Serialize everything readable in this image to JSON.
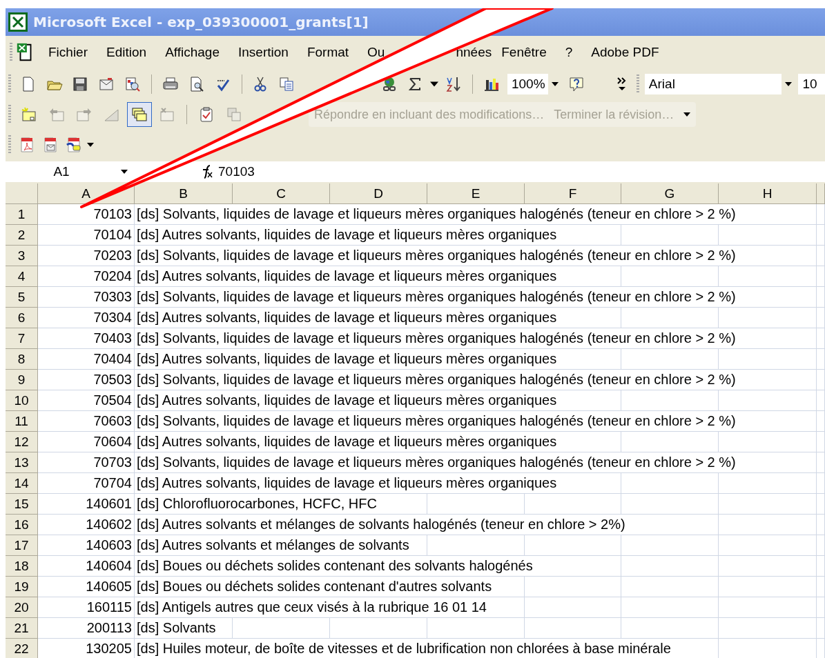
{
  "window": {
    "title": "Microsoft Excel - exp_039300001_grants[1]"
  },
  "menu": [
    "Fichier",
    "Edition",
    "Affichage",
    "Insertion",
    "Format",
    "Ou",
    "nnées",
    "Fenêtre",
    "?",
    "Adobe PDF"
  ],
  "standard_toolbar": {
    "zoom": "100%",
    "font": "Arial",
    "font_size": "10"
  },
  "reviewing_toolbar": {
    "buttons": [
      {
        "pressed": false,
        "disabled": false
      },
      {
        "pressed": false,
        "disabled": true
      },
      {
        "pressed": false,
        "disabled": true
      },
      {
        "pressed": false,
        "disabled": true
      },
      {
        "pressed": true,
        "disabled": false
      },
      {
        "pressed": false,
        "disabled": true
      },
      {
        "pressed": false,
        "disabled": false
      },
      {
        "pressed": false,
        "disabled": true
      }
    ],
    "commands": [
      {
        "label": "Répondre en incluant des modifications…",
        "disabled": true
      },
      {
        "label": "Terminer la révision…",
        "disabled": true
      }
    ]
  },
  "formula_bar": {
    "cell_reference": "A1",
    "formula": "70103"
  },
  "sheet": {
    "columns": [
      "A",
      "B",
      "C",
      "D",
      "E",
      "F",
      "G",
      "H"
    ],
    "rows": [
      {
        "header": "1",
        "a": "70103",
        "b": "[ds] Solvants, liquides de lavage et liqueurs mères organiques halogénés (teneur en chlore > 2 %)"
      },
      {
        "header": "2",
        "a": "70104",
        "b": "[ds] Autres solvants, liquides de lavage et liqueurs mères organiques"
      },
      {
        "header": "3",
        "a": "70203",
        "b": "[ds] Solvants, liquides de lavage et liqueurs mères organiques halogénés (teneur en chlore > 2 %)"
      },
      {
        "header": "4",
        "a": "70204",
        "b": "[ds] Autres solvants, liquides de lavage et liqueurs mères organiques"
      },
      {
        "header": "5",
        "a": "70303",
        "b": "[ds] Solvants, liquides de lavage et liqueurs mères organiques halogénés (teneur en chlore > 2 %)"
      },
      {
        "header": "6",
        "a": "70304",
        "b": "[ds] Autres solvants, liquides de lavage et liqueurs mères organiques"
      },
      {
        "header": "7",
        "a": "70403",
        "b": "[ds] Solvants, liquides de lavage et liqueurs mères organiques halogénés (teneur en chlore > 2 %)"
      },
      {
        "header": "8",
        "a": "70404",
        "b": "[ds] Autres solvants, liquides de lavage et liqueurs mères organiques"
      },
      {
        "header": "9",
        "a": "70503",
        "b": "[ds] Solvants, liquides de lavage et liqueurs mères organiques halogénés (teneur en chlore > 2 %)"
      },
      {
        "header": "10",
        "a": "70504",
        "b": "[ds] Autres solvants, liquides de lavage et liqueurs mères organiques"
      },
      {
        "header": "11",
        "a": "70603",
        "b": "[ds] Solvants, liquides de lavage et liqueurs mères organiques halogénés (teneur en chlore > 2 %)"
      },
      {
        "header": "12",
        "a": "70604",
        "b": "[ds] Autres solvants, liquides de lavage et liqueurs mères organiques"
      },
      {
        "header": "13",
        "a": "70703",
        "b": "[ds] Solvants, liquides de lavage et liqueurs mères organiques halogénés (teneur en chlore > 2 %)"
      },
      {
        "header": "14",
        "a": "70704",
        "b": "[ds] Autres solvants, liquides de lavage et liqueurs mères organiques"
      },
      {
        "header": "15",
        "a": "140601",
        "b": "[ds] Chlorofluorocarbones, HCFC, HFC"
      },
      {
        "header": "16",
        "a": "140602",
        "b": "[ds] Autres solvants et mélanges de solvants halogénés (teneur en chlore > 2%)"
      },
      {
        "header": "17",
        "a": "140603",
        "b": "[ds] Autres solvants et mélanges de solvants"
      },
      {
        "header": "18",
        "a": "140604",
        "b": "[ds] Boues ou déchets solides contenant des solvants halogénés"
      },
      {
        "header": "19",
        "a": "140605",
        "b": "[ds] Boues ou déchets solides contenant d'autres solvants"
      },
      {
        "header": "20",
        "a": "160115",
        "b": "[ds] Antigels autres que ceux visés à la rubrique 16 01 14"
      },
      {
        "header": "21",
        "a": "200113",
        "b": "[ds] Solvants"
      },
      {
        "header": "22",
        "a": "130205",
        "b": "[ds] Huiles moteur, de boîte de vitesses et de lubrification non chlorées à base minérale"
      }
    ]
  }
}
